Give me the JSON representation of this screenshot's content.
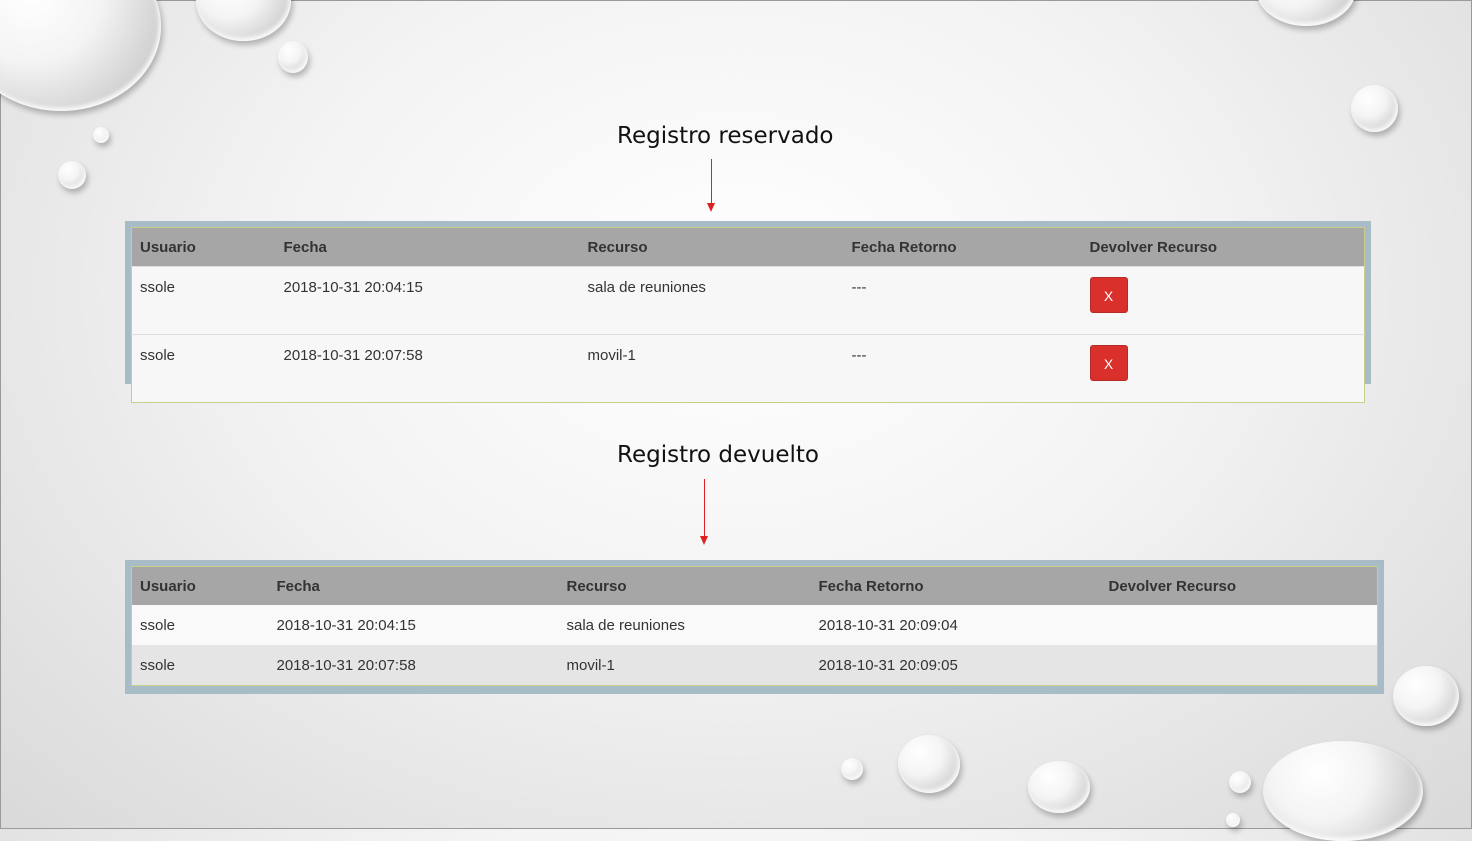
{
  "captions": {
    "reserved": "Registro reservado",
    "returned": "Registro devuelto"
  },
  "colors": {
    "arrow": "#e02020",
    "return_button": "#d9302c",
    "header_bg": "#a6a6a6"
  },
  "reserved_table": {
    "headers": [
      "Usuario",
      "Fecha",
      "Recurso",
      "Fecha Retorno",
      "Devolver Recurso"
    ],
    "rows": [
      {
        "usuario": "ssole",
        "fecha": "2018-10-31 20:04:15",
        "recurso": "sala de reuniones",
        "fecha_retorno": "---",
        "action": "X"
      },
      {
        "usuario": "ssole",
        "fecha": "2018-10-31 20:07:58",
        "recurso": "movil-1",
        "fecha_retorno": "---",
        "action": "X"
      }
    ]
  },
  "returned_table": {
    "headers": [
      "Usuario",
      "Fecha",
      "Recurso",
      "Fecha Retorno",
      "Devolver Recurso"
    ],
    "rows": [
      {
        "usuario": "ssole",
        "fecha": "2018-10-31 20:04:15",
        "recurso": "sala de reuniones",
        "fecha_retorno": "2018-10-31 20:09:04"
      },
      {
        "usuario": "ssole",
        "fecha": "2018-10-31 20:07:58",
        "recurso": "movil-1",
        "fecha_retorno": "2018-10-31 20:09:05"
      }
    ]
  }
}
